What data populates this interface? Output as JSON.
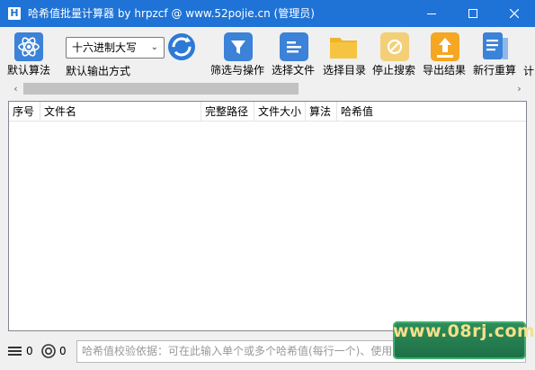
{
  "window": {
    "icon_letter": "H",
    "title": "哈希值批量计算器 by hrpzcf @ www.52pojie.cn  (管理员)"
  },
  "toolbar": {
    "atom_label": "默认算法",
    "format_select_value": "十六进制大写",
    "format_label": "默认输出方式",
    "filter_label": "筛选与操作",
    "select_file_label": "选择文件",
    "select_dir_label": "选择目录",
    "stop_label": "停止搜索",
    "export_label": "导出结果",
    "recalc_label": "新行重算",
    "overflow_label": "计"
  },
  "table": {
    "columns": [
      "序号",
      "文件名",
      "完整路径",
      "文件大小",
      "算法",
      "哈希值"
    ]
  },
  "status": {
    "files_count": "0",
    "tasks_count": "0",
    "hash_input_placeholder": "哈希值校验依据：可在此输入单个或多个哈希值(每行一个)、使用后缀名"
  },
  "watermark": "www.08rj.com",
  "colors": {
    "titlebar": "#1f73d6",
    "accent_blue": "#3b82d8",
    "folder_yellow": "#f5c542",
    "export_orange": "#f5a623"
  }
}
